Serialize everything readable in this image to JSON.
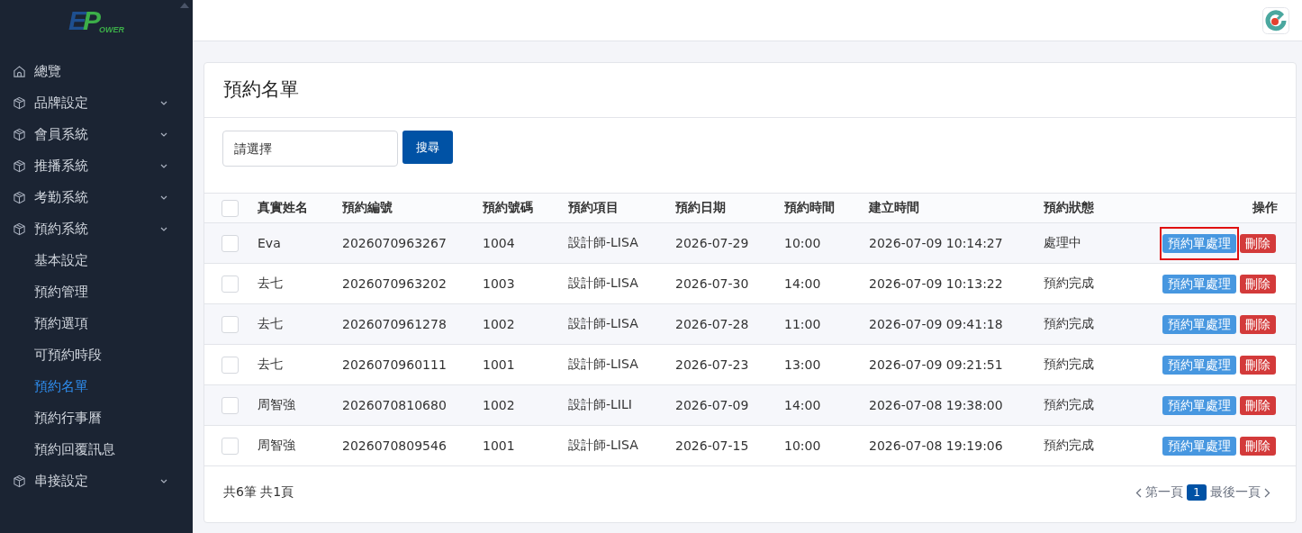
{
  "logo": {
    "letter_1": "E",
    "letter_2": "P",
    "rest": "OWER"
  },
  "sidebar": {
    "items": [
      {
        "label": "總覽",
        "expandable": false,
        "selected": false
      },
      {
        "label": "品牌設定",
        "expandable": true,
        "selected": false
      },
      {
        "label": "會員系統",
        "expandable": true,
        "selected": false
      },
      {
        "label": "推播系統",
        "expandable": true,
        "selected": false
      },
      {
        "label": "考勤系統",
        "expandable": true,
        "selected": false
      },
      {
        "label": "預約系統",
        "expandable": true,
        "selected": false,
        "children": [
          {
            "label": "基本設定",
            "selected": false
          },
          {
            "label": "預約管理",
            "selected": false
          },
          {
            "label": "預約選項",
            "selected": false
          },
          {
            "label": "可預約時段",
            "selected": false
          },
          {
            "label": "預約名單",
            "selected": true
          },
          {
            "label": "預約行事曆",
            "selected": false
          },
          {
            "label": "預約回覆訊息",
            "selected": false
          }
        ]
      },
      {
        "label": "串接設定",
        "expandable": true,
        "selected": false
      }
    ]
  },
  "page": {
    "title": "預約名單"
  },
  "search": {
    "placeholder": "請選擇",
    "button": "搜尋"
  },
  "table": {
    "columns": [
      "真實姓名",
      "預約編號",
      "預約號碼",
      "預約項目",
      "預約日期",
      "預約時間",
      "建立時間",
      "預約狀態",
      "操作"
    ],
    "header_checked": false,
    "rows": [
      {
        "checked": false,
        "cells": [
          "Eva",
          "2026070963267",
          "1004",
          "設計師-LISA",
          "2026-07-29",
          "10:00",
          "2026-07-09 10:14:27",
          "處理中"
        ],
        "actions": [
          "預約單處理",
          "刪除"
        ],
        "highlighted": true
      },
      {
        "checked": false,
        "cells": [
          "去七",
          "2026070963202",
          "1003",
          "設計師-LISA",
          "2026-07-30",
          "14:00",
          "2026-07-09 10:13:22",
          "預約完成"
        ],
        "actions": [
          "預約單處理",
          "刪除"
        ],
        "highlighted": false
      },
      {
        "checked": false,
        "cells": [
          "去七",
          "2026070961278",
          "1002",
          "設計師-LISA",
          "2026-07-28",
          "11:00",
          "2026-07-09 09:41:18",
          "預約完成"
        ],
        "actions": [
          "預約單處理",
          "刪除"
        ],
        "highlighted": false
      },
      {
        "checked": false,
        "cells": [
          "去七",
          "2026070960111",
          "1001",
          "設計師-LISA",
          "2026-07-23",
          "13:00",
          "2026-07-09 09:21:51",
          "預約完成"
        ],
        "actions": [
          "預約單處理",
          "刪除"
        ],
        "highlighted": false
      },
      {
        "checked": false,
        "cells": [
          "周智強",
          "2026070810680",
          "1002",
          "設計師-LILI",
          "2026-07-09",
          "14:00",
          "2026-07-08 19:38:00",
          "預約完成"
        ],
        "actions": [
          "預約單處理",
          "刪除"
        ],
        "highlighted": false
      },
      {
        "checked": false,
        "cells": [
          "周智強",
          "2026070809546",
          "1001",
          "設計師-LISA",
          "2026-07-15",
          "10:00",
          "2026-07-08 19:19:06",
          "預約完成"
        ],
        "actions": [
          "預約單處理",
          "刪除"
        ],
        "highlighted": false
      }
    ]
  },
  "footer": {
    "summary": "共6筆 共1頁",
    "pagination": {
      "first": "第一頁",
      "pages": [
        {
          "label": "1",
          "selected": true
        }
      ],
      "last": "最後一頁"
    }
  }
}
